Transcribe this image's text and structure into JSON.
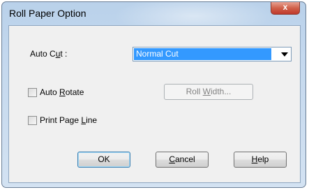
{
  "window": {
    "title": "Roll Paper Option",
    "close_glyph": "x"
  },
  "auto_cut": {
    "label_pre": "Auto C",
    "label_mnemonic": "u",
    "label_post": "t :",
    "selected": "Normal Cut"
  },
  "auto_rotate": {
    "label_pre": "Auto ",
    "label_mnemonic": "R",
    "label_post": "otate",
    "checked": false
  },
  "print_page_line": {
    "label_pre": "Print Page ",
    "label_mnemonic": "L",
    "label_post": "ine",
    "checked": false
  },
  "roll_width_button": {
    "label_pre": "Roll ",
    "label_mnemonic": "W",
    "label_post": "idth...",
    "enabled": false
  },
  "buttons": {
    "ok": "OK",
    "cancel_mnemonic": "C",
    "cancel_rest": "ancel",
    "help_mnemonic": "H",
    "help_rest": "elp"
  }
}
